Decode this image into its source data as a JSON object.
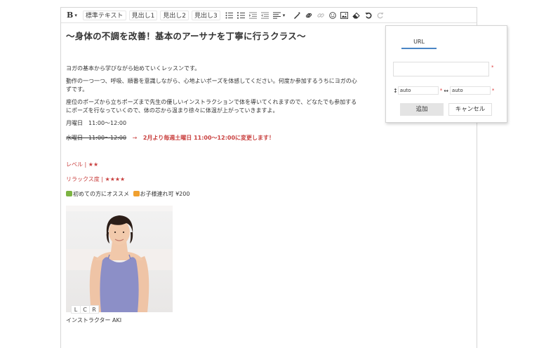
{
  "toolbar": {
    "bold": "B",
    "dropdown_caret": "▾",
    "styles": [
      "標準テキスト",
      "見出し1",
      "見出し2",
      "見出し3"
    ],
    "icons": [
      "bulleted-list-icon",
      "numbered-list-icon",
      "indent-icon",
      "outdent-icon",
      "align-icon",
      "text-color-icon",
      "link-icon",
      "unlink-icon",
      "emoji-icon",
      "image-icon",
      "eraser-icon",
      "undo-icon",
      "redo-icon"
    ]
  },
  "content": {
    "title": "〜身体の不調を改善！基本のアーサナを丁寧に行うクラス〜",
    "para1": "ヨガの基本から学びながら始めていくレッスンです。",
    "para2_line1": "動作の一つ一つ、呼吸、順番を意識しながら、心地よいポーズを体感してください。何度か参加するうちにヨガの心",
    "para2_line2": "ずです。",
    "para3_line1": "座位のポーズから立ちポーズまで先生の優しいインストラクションで体を導いてくれますので、どなたでも参加する",
    "para3_line2": "にポーズを行なっていくので、体の芯から温まり徐々に体温が上がっていきますよ。",
    "schedule_current": "月曜日　11:00〜12:00",
    "schedule_old": "水曜日　11:00〜12:00",
    "arrow": "→",
    "schedule_change": "2月より毎週土曜日 11:00〜12:00に変更します！",
    "level": "レベル | ★★",
    "relax": "リラックス度 | ★★★★",
    "tag1": "初めての方にオススメ",
    "tag2": "お子様連れ可 ¥200",
    "align_buttons": [
      "L",
      "C",
      "R"
    ],
    "caption": "インストラクター AKI"
  },
  "popup": {
    "tab_label": "URL",
    "url_value": "",
    "width_value": "auto",
    "height_value": "auto",
    "add_label": "追加",
    "cancel_label": "キャンセル",
    "required_mark": "*"
  },
  "colors": {
    "accent": "#4a86c5",
    "red": "#c9403f",
    "badge_green": "#7cb342",
    "badge_orange": "#f0a030"
  }
}
